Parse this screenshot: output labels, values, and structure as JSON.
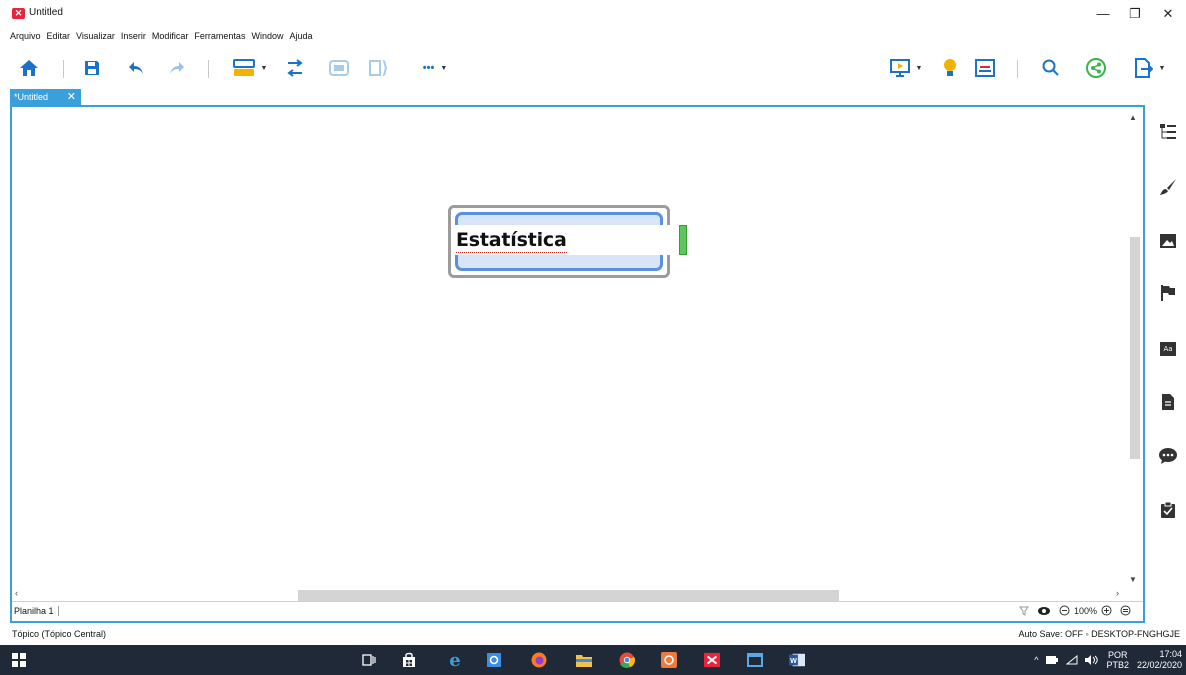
{
  "window": {
    "title": "Untitled",
    "minimize": "—",
    "maximize": "❐",
    "close": "✕"
  },
  "menu": [
    "Arquivo",
    "Editar",
    "Visualizar",
    "Inserir",
    "Modificar",
    "Ferramentas",
    "Window",
    "Ajuda"
  ],
  "toolbar": {
    "more_label": "•••"
  },
  "tab": {
    "label": "*Untitled",
    "close": "✕"
  },
  "topic": {
    "text": "Estatística"
  },
  "sheet": {
    "name": "Planilha 1",
    "zoom": "100%"
  },
  "status": {
    "left": "Tópico (Tópico Central)",
    "right": "Auto Save: OFF  ◦ DESKTOP-FNGHGJE"
  },
  "taskbar": {
    "lang_top": "POR",
    "lang_bottom": "PTB2",
    "time": "17:04",
    "date": "22/02/2020"
  },
  "colors": {
    "accent": "#3aa0dc",
    "topic_border": "#5b8fe0",
    "topic_fill": "#d8e5f8",
    "taskbar": "#1f2937",
    "app_logo": "#e8233b"
  }
}
